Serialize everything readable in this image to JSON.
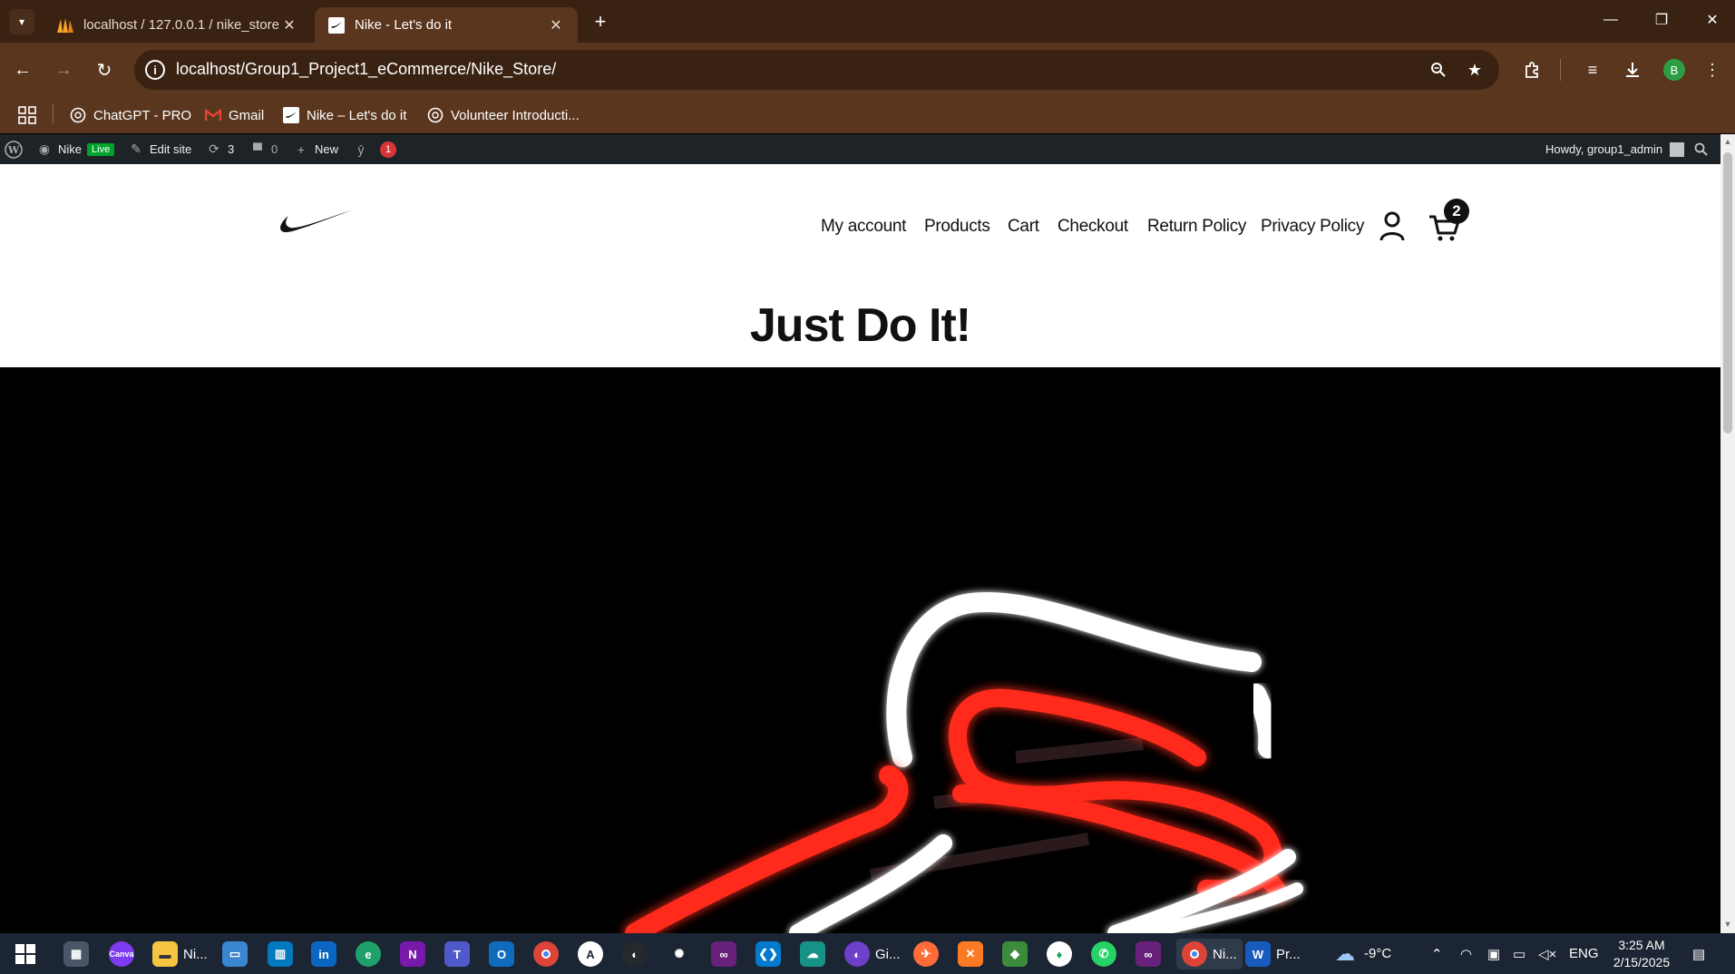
{
  "browser": {
    "tabs": [
      {
        "title": "localhost / 127.0.0.1 / nike_store",
        "active": false
      },
      {
        "title": "Nike - Let's do it",
        "active": true
      }
    ],
    "url": "localhost/Group1_Project1_eCommerce/Nike_Store/",
    "profile_initial": "B",
    "bookmarks": [
      {
        "label": "ChatGPT - PRO",
        "icon": "chatgpt-icon"
      },
      {
        "label": "Gmail",
        "icon": "gmail-icon"
      },
      {
        "label": "Nike – Let's do it",
        "icon": "nike-icon"
      },
      {
        "label": "Volunteer Introducti...",
        "icon": "chatgpt-icon"
      }
    ]
  },
  "wp_admin_bar": {
    "site_name": "Nike",
    "live_label": "Live",
    "edit_site": "Edit site",
    "updates_count": "3",
    "comments_count": "0",
    "new_label": "New",
    "yoast_count": "1",
    "howdy": "Howdy, group1_admin"
  },
  "site": {
    "nav": [
      "My account",
      "Products",
      "Cart",
      "Checkout",
      "Return Policy",
      "Privacy Policy"
    ],
    "cart_count": "2",
    "hero_title": "Just Do It!"
  },
  "taskbar": {
    "apps": [
      {
        "name": "start",
        "label": ""
      },
      {
        "name": "calculator",
        "label": ""
      },
      {
        "name": "canva",
        "label": ""
      },
      {
        "name": "file-explorer",
        "label": "Ni..."
      },
      {
        "name": "laptop",
        "label": ""
      },
      {
        "name": "trello",
        "label": ""
      },
      {
        "name": "linkedin",
        "label": ""
      },
      {
        "name": "edge",
        "label": ""
      },
      {
        "name": "onenote",
        "label": ""
      },
      {
        "name": "teams",
        "label": ""
      },
      {
        "name": "outlook",
        "label": ""
      },
      {
        "name": "chrome",
        "label": ""
      },
      {
        "name": "app-store",
        "label": ""
      },
      {
        "name": "github",
        "label": ""
      },
      {
        "name": "chatgpt",
        "label": ""
      },
      {
        "name": "visual-studio",
        "label": ""
      },
      {
        "name": "vscode",
        "label": ""
      },
      {
        "name": "gitkraken",
        "label": ""
      },
      {
        "name": "github-desktop",
        "label": "Gi..."
      },
      {
        "name": "postman",
        "label": ""
      },
      {
        "name": "xampp",
        "label": ""
      },
      {
        "name": "git-tools",
        "label": ""
      },
      {
        "name": "mongodb",
        "label": ""
      },
      {
        "name": "whatsapp",
        "label": ""
      },
      {
        "name": "visual-studio-2",
        "label": ""
      },
      {
        "name": "chrome-active",
        "label": "Ni..."
      },
      {
        "name": "word",
        "label": "Pr..."
      }
    ],
    "weather": "-9°C",
    "language": "ENG",
    "time": "3:25 AM",
    "date": "2/15/2025"
  },
  "colors": {
    "chrome_dark": "#3a2212",
    "chrome_toolbar": "#5a361e",
    "wp_bar": "#1d2327",
    "neon_red": "#ff2a1a",
    "neon_white": "#ffffff"
  }
}
